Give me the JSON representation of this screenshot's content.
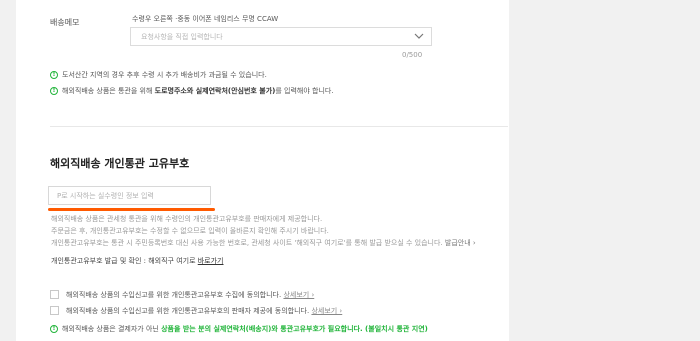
{
  "memo": {
    "label": "배송메모",
    "recipient_info": "수령우 오른쪽 ·중동 이어폰 네임리스 무명 CCAW",
    "select_placeholder": "요청사항을 직접 입력합니다",
    "counter": "0/500"
  },
  "notices": {
    "island": {
      "text_pre": "도서산간 지역의 경우 추후 수령 시 추가 배송비가 과금될 수 있습니다."
    },
    "overseas": {
      "text_pre": "해외직배송 상품은 통관을 위해 ",
      "text_bold": "도로명주소와 실제연락처(안심번호 불가)",
      "text_post": "를 입력해야 합니다."
    }
  },
  "customs_section": {
    "title": "해외직배송 개인통관 고유부호",
    "input_placeholder": "P로 시작하는 실수령인 정보 입력",
    "desc_line1": "해외직배송 상품은 관세청 통관을 위해 수령인의 개인통관고유부호를 판매자에게 제공합니다.",
    "desc_line2": "주문금은 후, 개인통관고유부호는 수정할 수 없으므로 입력이 올바른지 확인해 주시기 바랍니다.",
    "desc_line3": "개인통관고유부호는 통관 시 주민등록번호 대신 사용 가능한 번호로, 관세청 사이트 '해외직구 여기로'를 통해 발급 받으실 수 있습니다.",
    "desc_link": "발급안내 ›",
    "issue_text": "개인통관고유부호 발급 및 확인 : 해외직구 여기로 ",
    "issue_link": "바로가기"
  },
  "agreements": [
    {
      "text": "해외직배송 상품의 수입신고를 위한 개인통관고유부호 수집에 동의합니다.",
      "more": "상세보기 ›"
    },
    {
      "text": "해외직배송 상품의 수입신고를 위한 개인통관고유부호의 판매자 제공에 동의합니다.",
      "more": "상세보기 ›"
    }
  ],
  "final_notice": {
    "text_pre": "해외직배송 상품은 결제자가 아닌 ",
    "text_green": "상품을 받는 분의 실제연락처(배송지)와 통관고유부호가 필요합니다. (불일치시 통관 지연)"
  },
  "colors": {
    "accent_green": "#21b43a",
    "highlight_orange": "#ff5a00"
  }
}
